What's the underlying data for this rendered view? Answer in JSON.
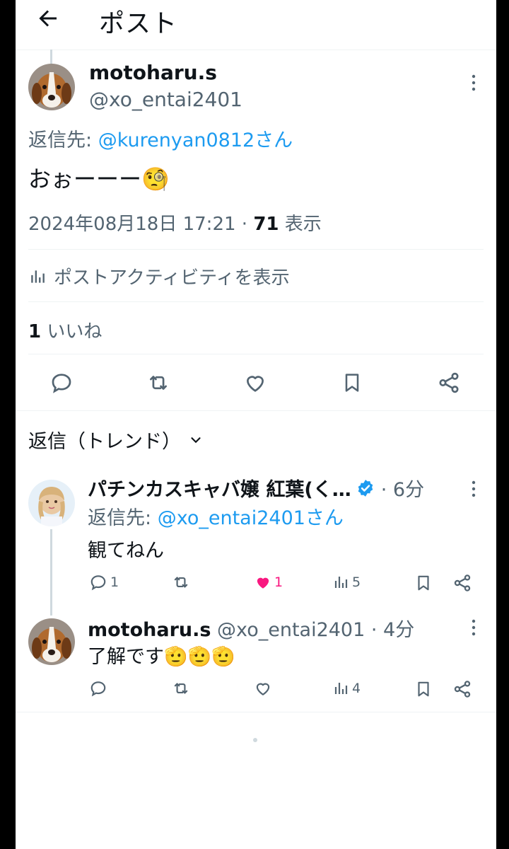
{
  "header": {
    "title": "ポスト"
  },
  "main_post": {
    "display_name": "motoharu.s",
    "handle": "@xo_entai2401",
    "reply_to_prefix": "返信先: ",
    "reply_to_handle": "@kurenyan0812さん",
    "text": "おぉーーー",
    "text_emoji": "🧐",
    "timestamp": "2024年08月18日 17:21 · ",
    "views_count": "71",
    "views_label": " 表示",
    "activity_label": "ポストアクティビティを表示",
    "likes_count": "1",
    "likes_label": " いいね"
  },
  "replies_sort_label": "返信（トレンド）",
  "replies": [
    {
      "display_name": "パチンカスキャバ嬢 紅葉(く…",
      "verified": true,
      "time": "· 6分",
      "reply_to_prefix": "返信先: ",
      "reply_to_handle": "@xo_entai2401さん",
      "text": "観てねん",
      "reply_count": "1",
      "like_count": "1",
      "view_count": "5"
    },
    {
      "display_name": "motoharu.s",
      "handle": "@xo_entai2401",
      "time": "· 4分",
      "text": "了解です",
      "text_emoji": "🫡🫡🫡",
      "view_count": "4"
    }
  ],
  "colors": {
    "accent": "#1d9bf0",
    "like": "#f91880",
    "text": "#0f1419",
    "muted": "#536471"
  }
}
